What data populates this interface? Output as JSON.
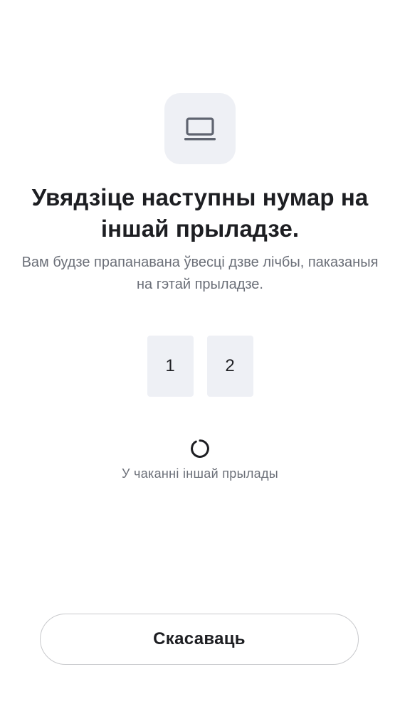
{
  "header": {
    "icon": "laptop-icon",
    "title": "Увядзіце наступны нумар на іншай прыладзе.",
    "subtitle": "Вам будзе прапанавана ўвесці дзве лічбы, паказаныя на гэтай прыладзе."
  },
  "code": {
    "digits": [
      "1",
      "2"
    ]
  },
  "status": {
    "icon": "loading-spinner-icon",
    "text": "У чаканні іншай прылады"
  },
  "actions": {
    "cancel_label": "Скасаваць"
  },
  "colors": {
    "tile_background": "#eef0f5",
    "icon_color": "#5f6470",
    "text_primary": "#1d1e22",
    "text_secondary": "#6b6f78",
    "button_border": "#c8c9cc"
  }
}
